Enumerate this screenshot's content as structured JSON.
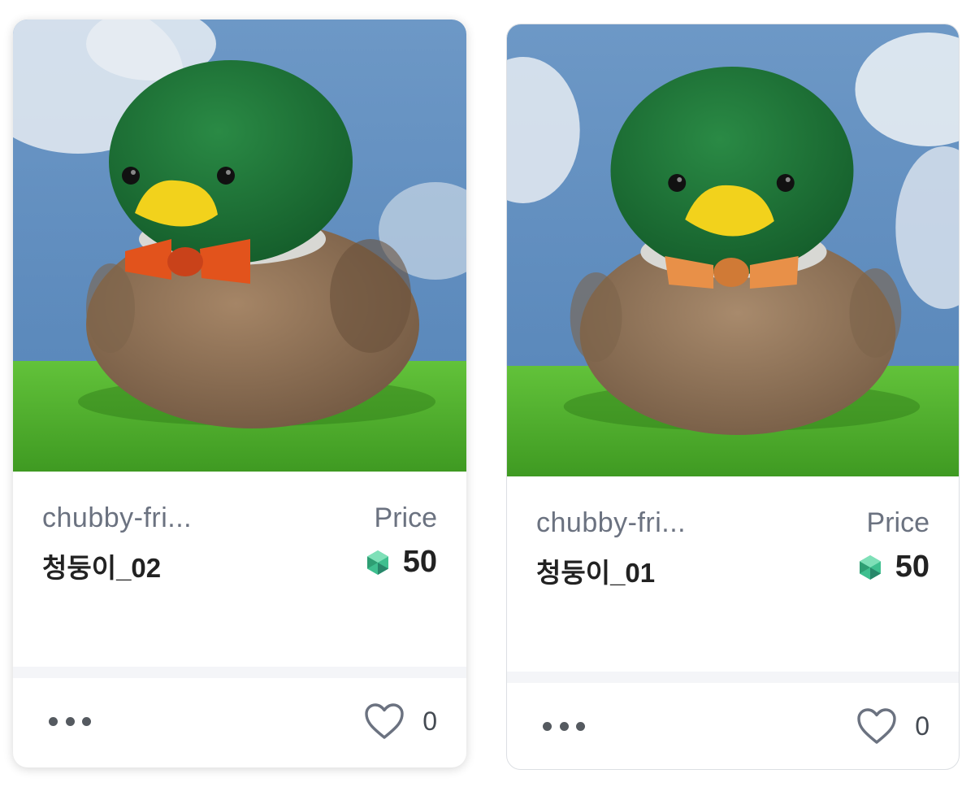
{
  "cards": [
    {
      "collection": "chubby-fri...",
      "name": "청둥이_02",
      "price_label": "Price",
      "price": "50",
      "currency_icon": "klay-icon",
      "likes": "0",
      "bowtie_color": "#e2531c",
      "image_alt": "청둥이_02"
    },
    {
      "collection": "chubby-fri...",
      "name": "청둥이_01",
      "price_label": "Price",
      "price": "50",
      "currency_icon": "klay-icon",
      "likes": "0",
      "bowtie_color": "#e89048",
      "image_alt": "청둥이_01"
    }
  ],
  "colors": {
    "sky": "#5f8fc0",
    "grass": "#4cae2a",
    "duck_head": "#1f7a3a",
    "beak": "#f2d21c",
    "body": "#8e7054",
    "klay_accent": "#3fbf8f"
  }
}
